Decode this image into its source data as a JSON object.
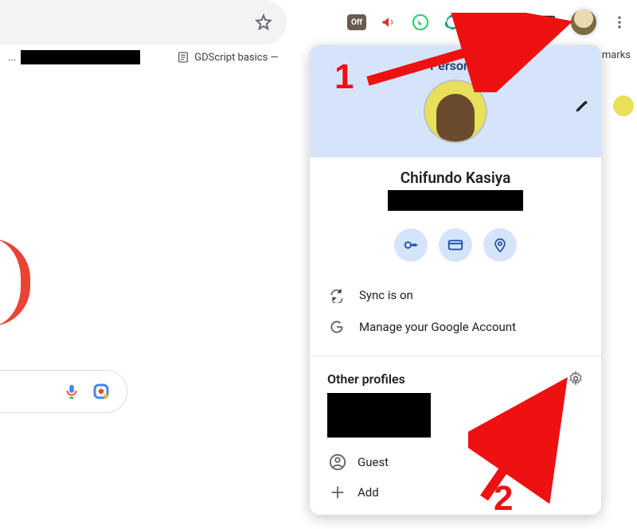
{
  "omnibox": {
    "star_title": "Bookmark this tab"
  },
  "toolbar": {
    "extensions": [
      {
        "name": "off-extension",
        "label": "Off"
      },
      {
        "name": "megaphone-extension"
      },
      {
        "name": "whatsapp-extension"
      },
      {
        "name": "chatgpt-extension"
      },
      {
        "name": "devtools-extension"
      }
    ],
    "extensions_button": "Extensions",
    "side_panel": "Side panel",
    "profile": "Profile",
    "menu": "Customize and control Google Chrome"
  },
  "bookmarks": {
    "left_suffix": "...",
    "gdscript": "GDScript basics —",
    "right_fragment": "marks"
  },
  "profile_card": {
    "person_label": "Person 1",
    "edit_title": "Edit profile",
    "display_name": "Chifundo Kasiya",
    "chips": {
      "passwords": "Passwords",
      "payments": "Payment methods",
      "addresses": "Addresses"
    },
    "sync_label": "Sync is on",
    "manage_label": "Manage your Google Account",
    "other_profiles_title": "Other profiles",
    "gear_title": "Manage profiles",
    "guest_label": "Guest",
    "add_label": "Add"
  },
  "search_capsule": {
    "mic_title": "Search by voice",
    "lens_title": "Search by image"
  },
  "annotations": {
    "one": "1",
    "two": "2"
  }
}
